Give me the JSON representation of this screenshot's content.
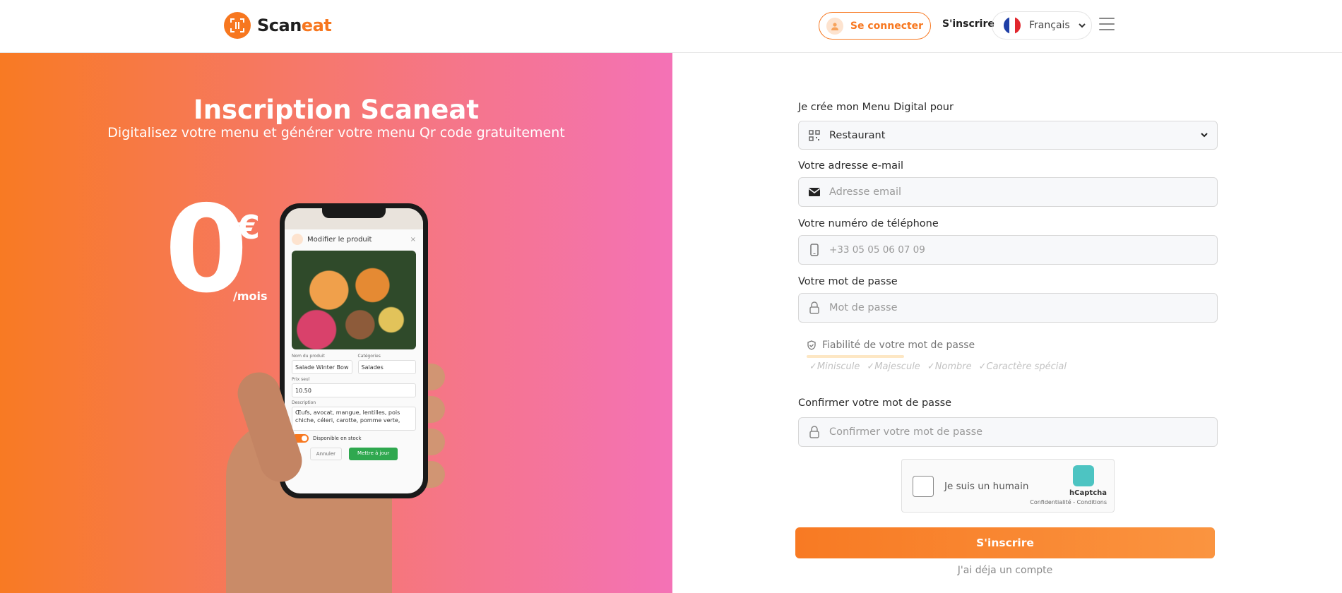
{
  "header": {
    "logo_part1": "Scan",
    "logo_part2": "eat",
    "login_label": "Se connecter",
    "signup_label": "S'inscrire",
    "language": "Français"
  },
  "hero": {
    "title": "Inscription Scaneat",
    "subtitle": "Digitalisez votre menu et générer votre menu Qr code gratuitement",
    "price": "0",
    "currency": "€",
    "period": "/mois"
  },
  "phone": {
    "modal_title": "Modifier le produit",
    "name_label": "Nom du produit",
    "name_value": "Salade Winter Bow",
    "category_label": "Catégories",
    "category_value": "Salades",
    "price_label": "Prix seul",
    "price_value": "10.50",
    "description_label": "Description",
    "description_value": "Œufs, avocat, mangue, lentilles, pois chiche, céleri, carotte, pomme verte,",
    "stock_label": "Disponible en stock",
    "cancel_label": "Annuler",
    "save_label": "Mettre à jour"
  },
  "form": {
    "menu_for_label": "Je crée mon Menu Digital pour",
    "menu_for_value": "Restaurant",
    "email_label": "Votre adresse e-mail",
    "email_placeholder": "Adresse email",
    "phone_label": "Votre numéro de téléphone",
    "phone_placeholder": "+33 05 05 06 07 09",
    "password_label": "Votre mot de passe",
    "password_placeholder": "Mot de passe",
    "strength_label": "Fiabilité de votre mot de passe",
    "rules": [
      "✓Miniscule",
      "✓Majescule",
      "✓Nombre",
      "✓Caractère spécial"
    ],
    "confirm_label": "Confirmer votre mot de passe",
    "confirm_placeholder": "Confirmer votre mot de passe",
    "captcha_text": "Je suis un humain",
    "captcha_brand": "hCaptcha",
    "captcha_links": "Confidentialité - Conditions",
    "submit_label": "S'inscrire",
    "have_account": "J'ai déja un compte"
  },
  "colors": {
    "accent": "#f7771f",
    "gradient_start": "#f87a23",
    "gradient_end": "#f472b6"
  }
}
